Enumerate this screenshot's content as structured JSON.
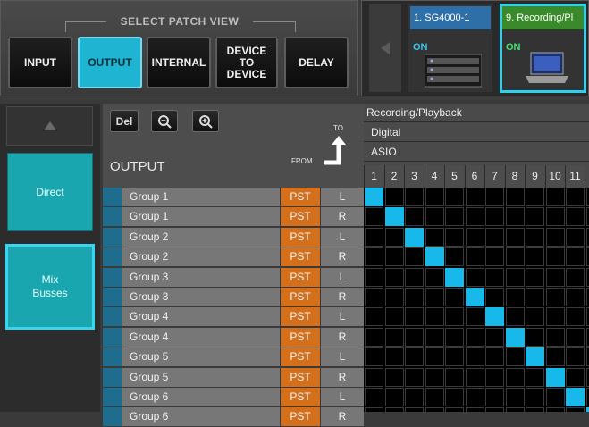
{
  "patch_view": {
    "title": "SELECT PATCH VIEW",
    "buttons": [
      {
        "id": "input",
        "label": "INPUT",
        "active": false
      },
      {
        "id": "output",
        "label": "OUTPUT",
        "active": true
      },
      {
        "id": "internal",
        "label": "INTERNAL",
        "active": false
      },
      {
        "id": "device-to-device",
        "label": "DEVICE TO DEVICE",
        "active": false
      },
      {
        "id": "delay",
        "label": "DELAY",
        "active": false
      }
    ]
  },
  "devices": [
    {
      "name": "1. SG4000-1",
      "status": "ON",
      "color": "#2f6fa8",
      "selected": false
    },
    {
      "name": "9. Recording/Pl",
      "status": "ON",
      "color": "#3a8a2c",
      "selected": true
    }
  ],
  "sidebar": {
    "items": [
      {
        "label": "Direct",
        "selected": false
      },
      {
        "label": "Mix Busses",
        "selected": true
      }
    ]
  },
  "toolbar": {
    "del_label": "Del",
    "zoom_out_icon": "zoom-out-icon",
    "zoom_in_icon": "zoom-in-icon"
  },
  "header": {
    "output_title": "OUTPUT",
    "to_label": "TO",
    "from_label": "FROM"
  },
  "columns": {
    "device": "Recording/Playback",
    "type": "Digital",
    "subtype": "ASIO",
    "numbers": [
      "1",
      "2",
      "3",
      "4",
      "5",
      "6",
      "7",
      "8",
      "9",
      "10",
      "11"
    ]
  },
  "rows": [
    {
      "name": "Group 1",
      "pst": "PST",
      "side": "L"
    },
    {
      "name": "Group 1",
      "pst": "PST",
      "side": "R"
    },
    {
      "name": "Group 2",
      "pst": "PST",
      "side": "L"
    },
    {
      "name": "Group 2",
      "pst": "PST",
      "side": "R"
    },
    {
      "name": "Group 3",
      "pst": "PST",
      "side": "L"
    },
    {
      "name": "Group 3",
      "pst": "PST",
      "side": "R"
    },
    {
      "name": "Group 4",
      "pst": "PST",
      "side": "L"
    },
    {
      "name": "Group 4",
      "pst": "PST",
      "side": "R"
    },
    {
      "name": "Group 5",
      "pst": "PST",
      "side": "L"
    },
    {
      "name": "Group 5",
      "pst": "PST",
      "side": "R"
    },
    {
      "name": "Group 6",
      "pst": "PST",
      "side": "L"
    },
    {
      "name": "Group 6",
      "pst": "PST",
      "side": "R"
    }
  ],
  "patches": [
    [
      0,
      0
    ],
    [
      1,
      1
    ],
    [
      2,
      2
    ],
    [
      3,
      3
    ],
    [
      4,
      4
    ],
    [
      5,
      5
    ],
    [
      6,
      6
    ],
    [
      7,
      7
    ],
    [
      8,
      8
    ],
    [
      9,
      9
    ],
    [
      10,
      10
    ],
    [
      11,
      11
    ]
  ],
  "colors": {
    "accent": "#1fb4d2",
    "patch_on": "#16b9ea",
    "pst": "#d46f1c",
    "list": "#19a6ae"
  }
}
